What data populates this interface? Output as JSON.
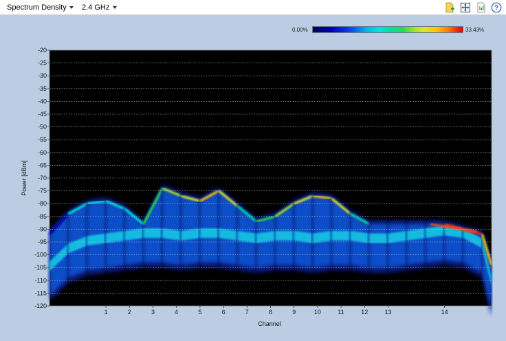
{
  "toolbar": {
    "view_dropdown": "Spectrum Density",
    "band_dropdown": "2.4 GHz",
    "icons": [
      "add-note-icon",
      "fit-view-icon",
      "export-icon",
      "help-icon"
    ],
    "help_glyph": "?"
  },
  "legend": {
    "min_label": "0.00%",
    "max_label": "33.43%",
    "colors": [
      "#00005a",
      "#0000b4",
      "#0a3ce6",
      "#00b4f0",
      "#00e6dc",
      "#00e0a0",
      "#28dc50",
      "#a0e628",
      "#dce628",
      "#ffc800",
      "#ff8200",
      "#ff2800",
      "#e60000"
    ]
  },
  "chart_data": {
    "type": "heatmap",
    "xlabel": "Channel",
    "ylabel": "Power [dBm]",
    "ylim": [
      -120,
      -20
    ],
    "yticks": [
      -20,
      -25,
      -30,
      -35,
      -40,
      -45,
      -50,
      -55,
      -60,
      -65,
      -70,
      -75,
      -80,
      -85,
      -90,
      -95,
      -100,
      -105,
      -110,
      -115,
      -120
    ],
    "x_tick_labels": [
      "1",
      "2",
      "3",
      "4",
      "5",
      "6",
      "7",
      "8",
      "9",
      "10",
      "11",
      "12",
      "13",
      "14"
    ],
    "x_tick_mhz": [
      2412,
      2417,
      2422,
      2427,
      2432,
      2437,
      2442,
      2447,
      2452,
      2457,
      2462,
      2467,
      2472,
      2484
    ],
    "xlim_mhz": [
      2400,
      2494
    ],
    "grid": true,
    "background": "#000000",
    "density_profile": {
      "mhz": [
        2400,
        2404,
        2408,
        2412,
        2416,
        2420,
        2424,
        2428,
        2432,
        2436,
        2440,
        2444,
        2448,
        2452,
        2456,
        2460,
        2464,
        2468,
        2472,
        2476,
        2480,
        2484,
        2488,
        2492,
        2494
      ],
      "noise_floor_dbm": [
        -104,
        -97,
        -94,
        -93,
        -92,
        -91,
        -91,
        -92,
        -91,
        -91,
        -92,
        -93,
        -92,
        -92,
        -93,
        -92,
        -92,
        -93,
        -93,
        -92,
        -91,
        -90,
        -91,
        -95,
        -110
      ],
      "signal_top_dbm": [
        -92,
        -84,
        -80,
        -79,
        -82,
        -88,
        -74,
        -77,
        -79,
        -75,
        -81,
        -87,
        -85,
        -80,
        -77,
        -78,
        -84,
        -88,
        -88,
        -88,
        -88,
        -88,
        -90,
        -92,
        -104
      ],
      "peak_density_pct": [
        4,
        10,
        12,
        12,
        10,
        16,
        20,
        22,
        24,
        22,
        14,
        18,
        20,
        22,
        24,
        22,
        14,
        12,
        10,
        10,
        30,
        32,
        30,
        26,
        8
      ]
    }
  }
}
